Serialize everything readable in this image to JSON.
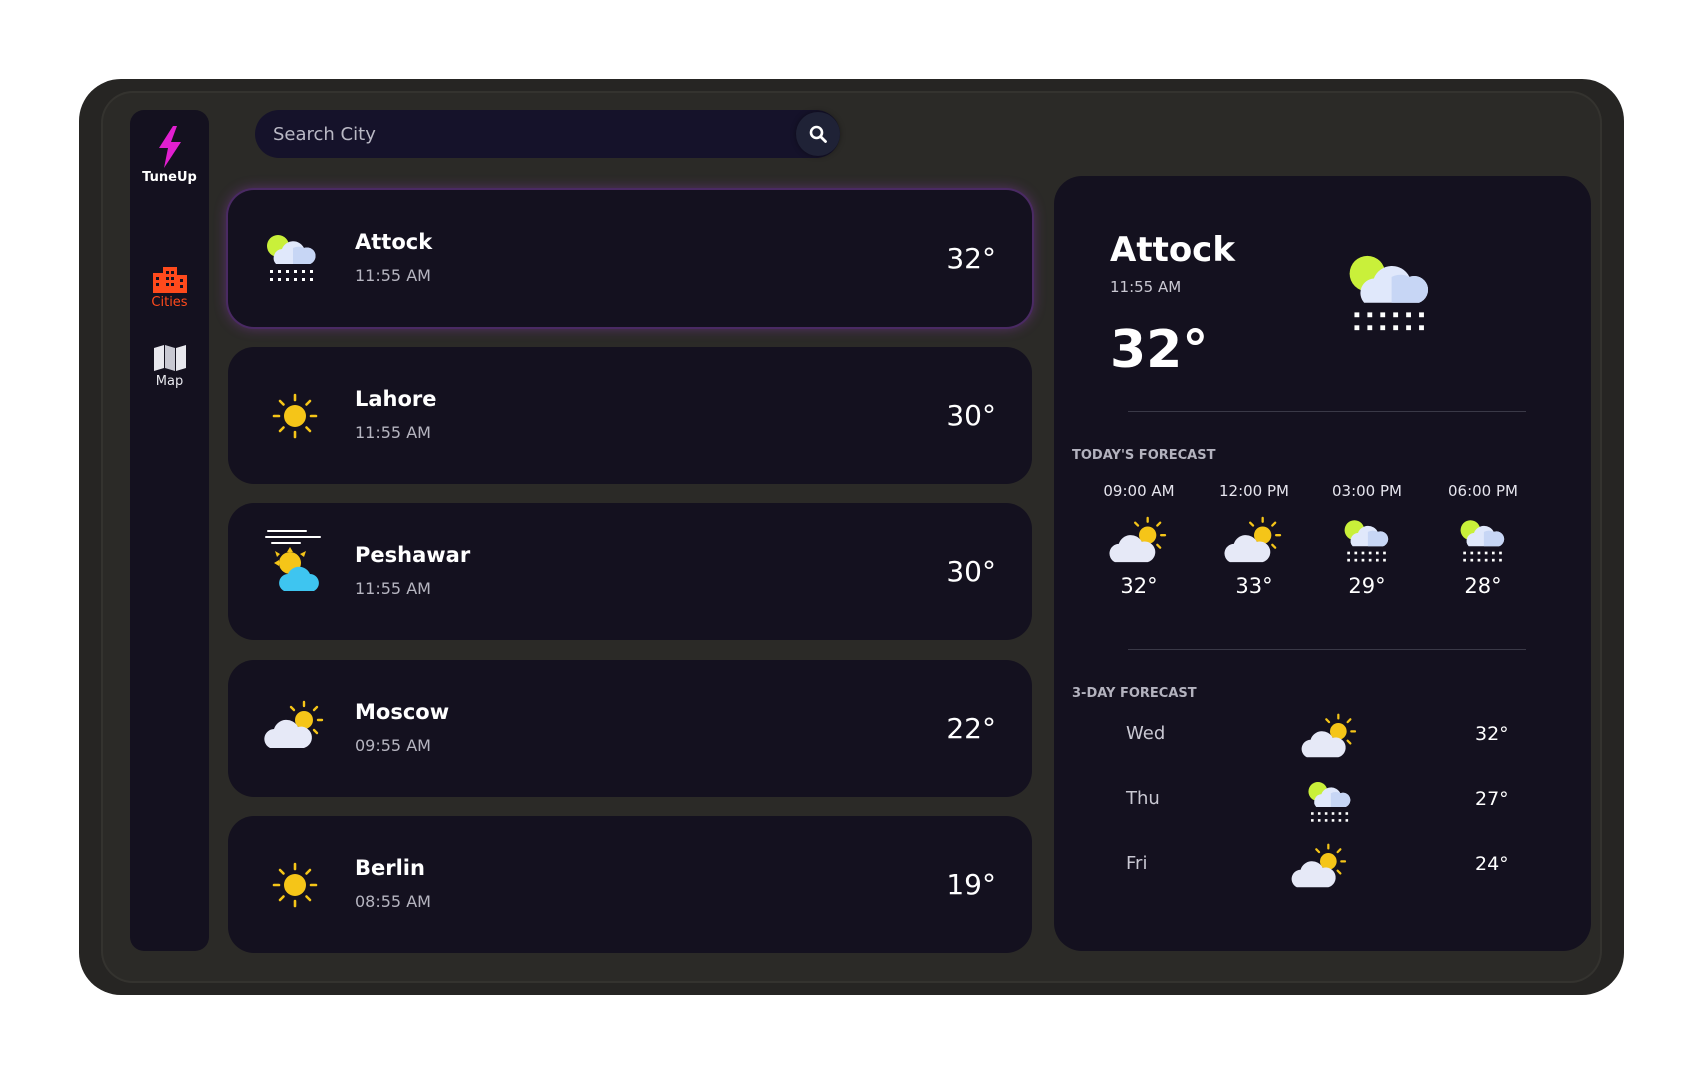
{
  "app": {
    "name": "TuneUp"
  },
  "sidebar": {
    "items": [
      {
        "label": "Cities",
        "icon": "building-icon",
        "active": true
      },
      {
        "label": "Map",
        "icon": "map-icon",
        "active": false
      }
    ]
  },
  "search": {
    "placeholder": "Search City",
    "value": ""
  },
  "cities": [
    {
      "name": "Attock",
      "time": "11:55 AM",
      "temp": "32°",
      "icon": "sun-cloud-snow-icon",
      "selected": true
    },
    {
      "name": "Lahore",
      "time": "11:55 AM",
      "temp": "30°",
      "icon": "sun-icon"
    },
    {
      "name": "Peshawar",
      "time": "11:55 AM",
      "temp": "30°",
      "icon": "windy-sun-cloud-icon"
    },
    {
      "name": "Moscow",
      "time": "09:55 AM",
      "temp": "22°",
      "icon": "partly-cloudy-icon"
    },
    {
      "name": "Berlin",
      "time": "08:55 AM",
      "temp": "19°",
      "icon": "sun-icon"
    }
  ],
  "detail": {
    "city": "Attock",
    "time": "11:55 AM",
    "temp": "32°",
    "icon": "sun-cloud-snow-icon",
    "today_title": "TODAY'S FORECAST",
    "hourly": [
      {
        "time": "09:00 AM",
        "temp": "32°",
        "icon": "partly-cloudy-icon"
      },
      {
        "time": "12:00 PM",
        "temp": "33°",
        "icon": "partly-cloudy-icon"
      },
      {
        "time": "03:00 PM",
        "temp": "29°",
        "icon": "sun-cloud-snow-icon"
      },
      {
        "time": "06:00 PM",
        "temp": "28°",
        "icon": "sun-cloud-snow-icon"
      }
    ],
    "daily_title": "3-DAY FORECAST",
    "daily": [
      {
        "day": "Wed",
        "temp": "32°",
        "icon": "partly-cloudy-icon"
      },
      {
        "day": "Thu",
        "temp": "27°",
        "icon": "sun-cloud-snow-icon"
      },
      {
        "day": "Fri",
        "temp": "24°",
        "icon": "partly-cloudy-icon"
      }
    ]
  },
  "colors": {
    "accent_active": "#ff4a1c",
    "logo": "#e21fd0",
    "card_bg": "#14111f",
    "frame_bg": "#262523",
    "sun": "#f5c518"
  }
}
